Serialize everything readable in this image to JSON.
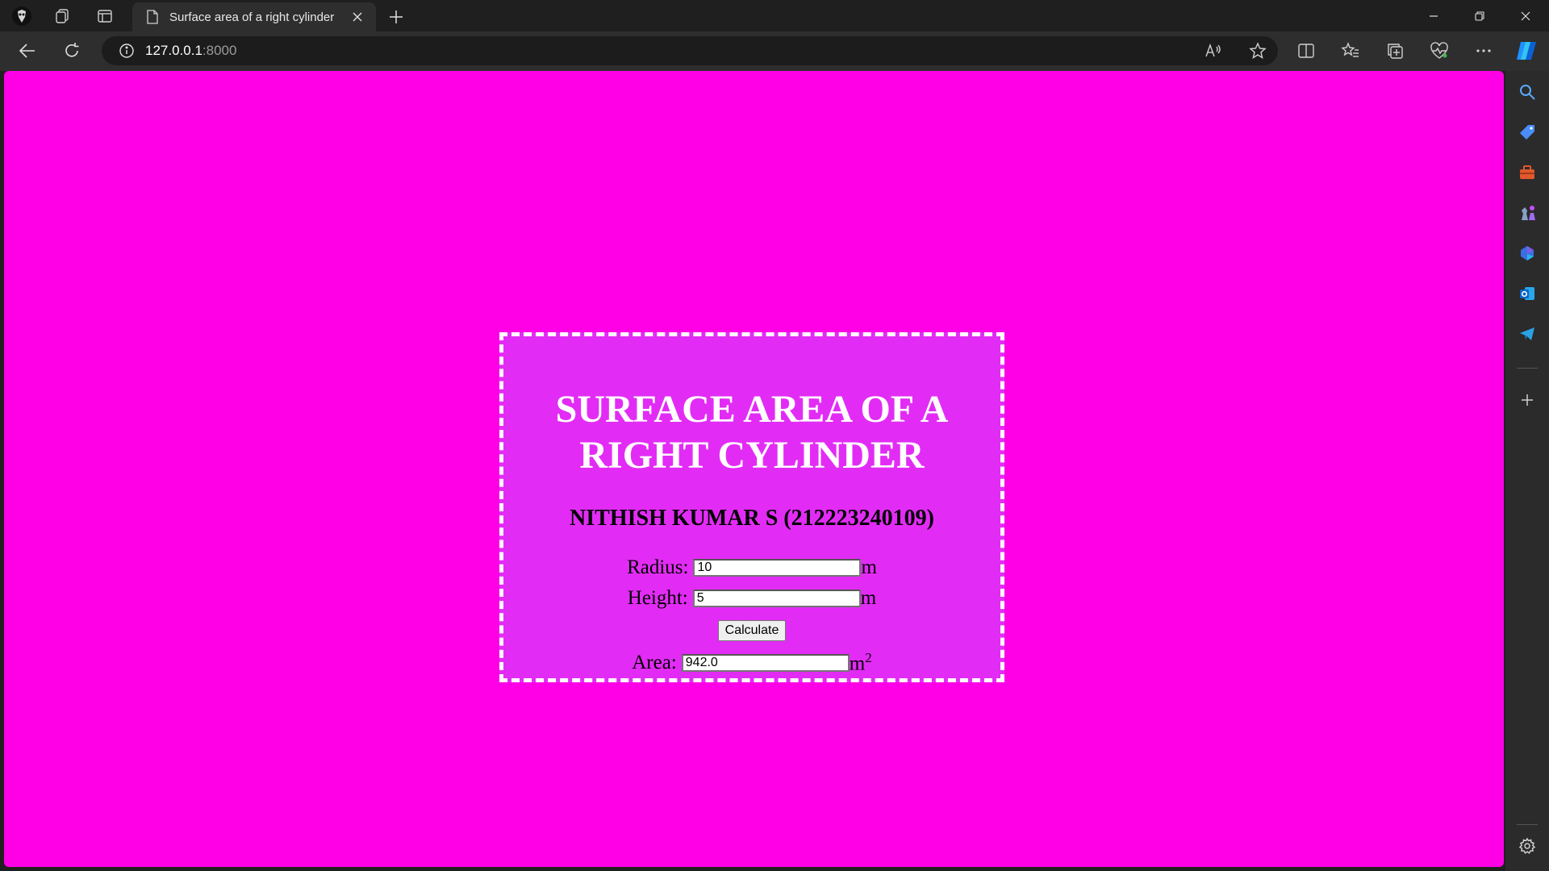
{
  "browser": {
    "tab": {
      "title": "Surface area of a right cylinder"
    },
    "address": {
      "host": "127.0.0.1",
      "port": ":8000"
    },
    "icons": {
      "profile": "profile-avatar-icon",
      "workspaces": "workspaces-icon",
      "tab_actions": "vertical-tabs-icon",
      "page": "page-icon",
      "close_tab": "close-icon",
      "new_tab": "plus-icon",
      "back": "back-arrow-icon",
      "refresh": "refresh-icon",
      "site_info": "info-icon",
      "read_aloud": "read-aloud-icon",
      "favorite": "star-icon",
      "split_screen": "split-screen-icon",
      "favorites": "favorites-icon",
      "collections": "collections-icon",
      "browser_essentials": "heart-pulse-icon",
      "more": "more-icon",
      "copilot": "copilot-icon"
    },
    "sidebar_icons": [
      "search-icon",
      "shopping-tag-icon",
      "tools-icon",
      "games-icon",
      "microsoft-365-icon",
      "outlook-icon",
      "telegram-icon",
      "add-icon",
      "settings-icon"
    ]
  },
  "page": {
    "background": "#ff00e6",
    "card_background": "#e22cf5",
    "title": "SURFACE AREA OF A RIGHT CYLINDER",
    "author": "NITHISH KUMAR S (212223240109)",
    "radius": {
      "label": "Radius:",
      "value": "10",
      "unit": "m"
    },
    "height": {
      "label": "Height:",
      "value": "5",
      "unit": "m"
    },
    "calculate_label": "Calculate",
    "area": {
      "label": "Area:",
      "value": "942.0",
      "unit": "m",
      "unit_sup": "2"
    }
  }
}
